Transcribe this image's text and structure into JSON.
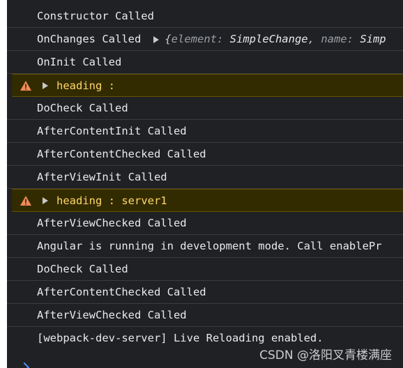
{
  "console": {
    "lines": [
      {
        "text": "Constructor Called"
      },
      {
        "text": "OnChanges Called",
        "object": {
          "open": "{",
          "k1": "element",
          "v1": "SimpleChange",
          "k2": "name",
          "v2": "Simp"
        }
      },
      {
        "text": "OnInit Called"
      },
      {
        "text": "heading :",
        "level": "warning"
      },
      {
        "text": "DoCheck Called"
      },
      {
        "text": "AfterContentInit Called"
      },
      {
        "text": "AfterContentChecked Called"
      },
      {
        "text": "AfterViewInit Called"
      },
      {
        "text": "heading : server1",
        "level": "warning"
      },
      {
        "text": "AfterViewChecked Called"
      },
      {
        "text": "Angular is running in development mode. Call enablePr"
      },
      {
        "text": "DoCheck Called"
      },
      {
        "text": "AfterContentChecked Called"
      },
      {
        "text": "AfterViewChecked Called"
      },
      {
        "text": "[webpack-dev-server] Live Reloading enabled."
      }
    ]
  },
  "watermark": "CSDN @洛阳叉青楼满座",
  "colors": {
    "background": "#202124",
    "text": "#e8eaed",
    "warning_text": "#ffd76e",
    "warning_bg": "#332b00",
    "warning_icon": "#f28b54"
  }
}
